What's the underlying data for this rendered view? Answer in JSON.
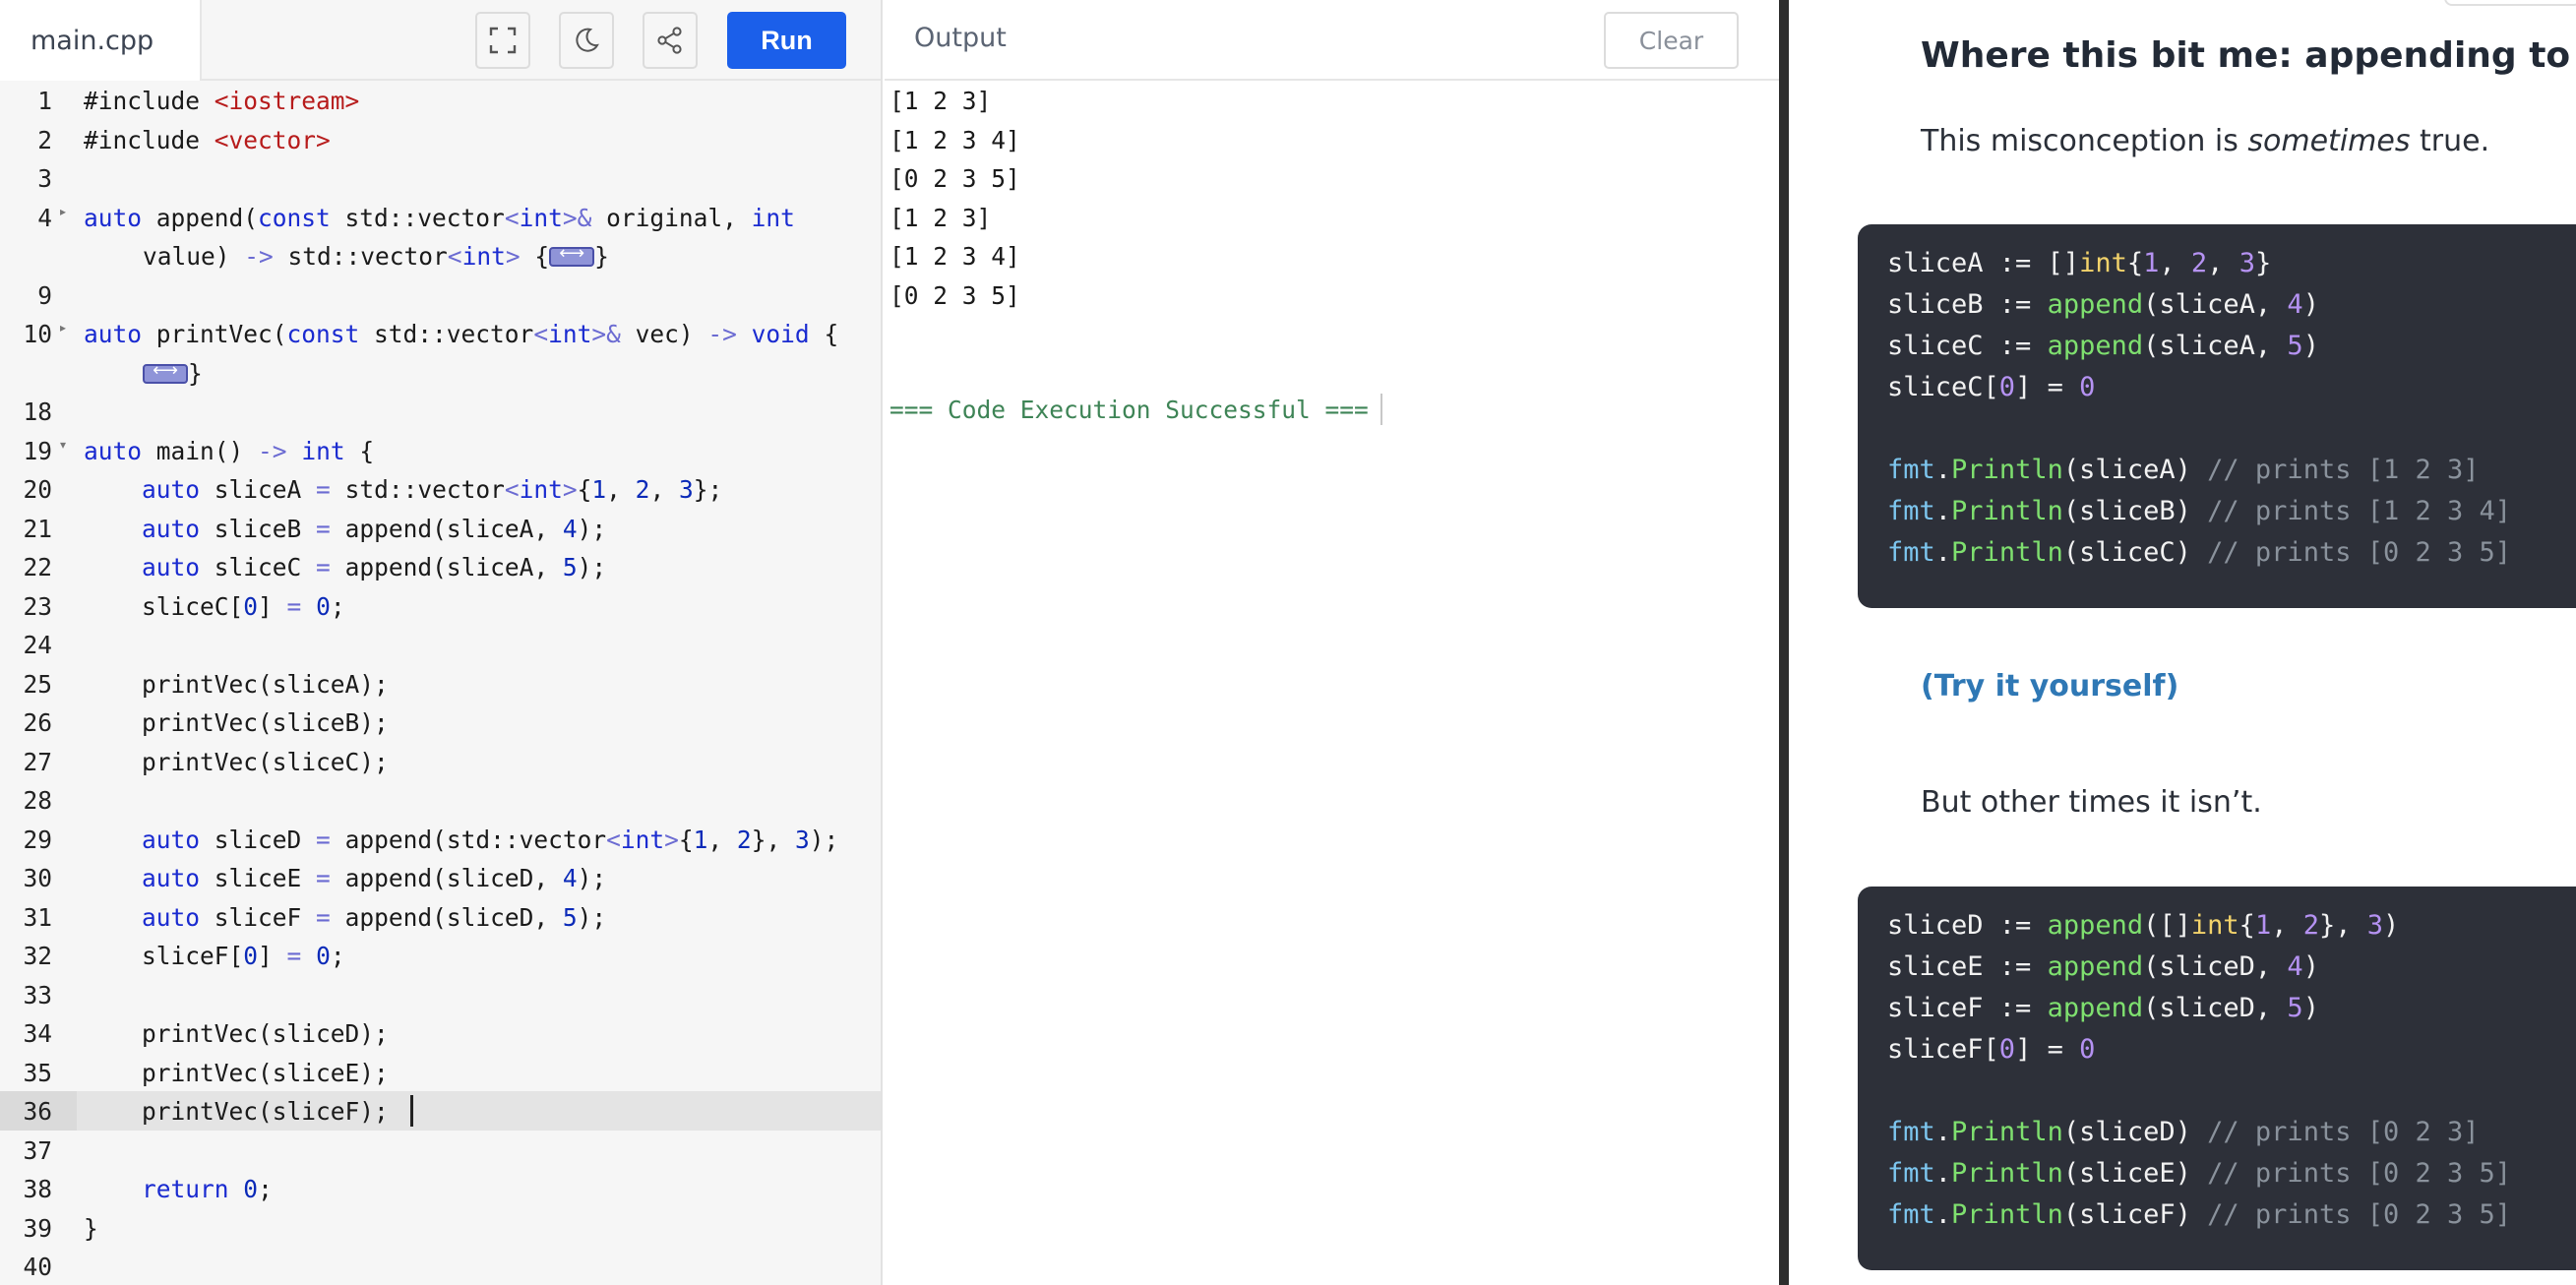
{
  "editor": {
    "file_tab": "main.cpp",
    "run_label": "Run",
    "icons": [
      "fullscreen-icon",
      "moon-icon",
      "share-icon"
    ],
    "lines": [
      {
        "n": "1",
        "code": "#include <iostream>"
      },
      {
        "n": "2",
        "code": "#include <vector>"
      },
      {
        "n": "3",
        "code": ""
      },
      {
        "n": "4",
        "code": "auto append(const std::vector<int>& original, int",
        "wrap": "value) -> std::vector<int> {⟷}"
      },
      {
        "n": "9",
        "code": ""
      },
      {
        "n": "10",
        "code": "auto printVec(const std::vector<int>& vec) -> void {",
        "wrap": "⟷}"
      },
      {
        "n": "18",
        "code": ""
      },
      {
        "n": "19",
        "code": "auto main() -> int {"
      },
      {
        "n": "20",
        "code": "    auto sliceA = std::vector<int>{1, 2, 3};"
      },
      {
        "n": "21",
        "code": "    auto sliceB = append(sliceA, 4);"
      },
      {
        "n": "22",
        "code": "    auto sliceC = append(sliceA, 5);"
      },
      {
        "n": "23",
        "code": "    sliceC[0] = 0;"
      },
      {
        "n": "24",
        "code": ""
      },
      {
        "n": "25",
        "code": "    printVec(sliceA);"
      },
      {
        "n": "26",
        "code": "    printVec(sliceB);"
      },
      {
        "n": "27",
        "code": "    printVec(sliceC);"
      },
      {
        "n": "28",
        "code": ""
      },
      {
        "n": "29",
        "code": "    auto sliceD = append(std::vector<int>{1, 2}, 3);"
      },
      {
        "n": "30",
        "code": "    auto sliceE = append(sliceD, 4);"
      },
      {
        "n": "31",
        "code": "    auto sliceF = append(sliceD, 5);"
      },
      {
        "n": "32",
        "code": "    sliceF[0] = 0;"
      },
      {
        "n": "33",
        "code": ""
      },
      {
        "n": "34",
        "code": "    printVec(sliceD);"
      },
      {
        "n": "35",
        "code": "    printVec(sliceE);"
      },
      {
        "n": "36",
        "code": "    printVec(sliceF); "
      },
      {
        "n": "37",
        "code": ""
      },
      {
        "n": "38",
        "code": "    return 0;"
      },
      {
        "n": "39",
        "code": "}"
      },
      {
        "n": "40",
        "code": ""
      }
    ]
  },
  "output": {
    "title": "Output",
    "clear_label": "Clear",
    "lines": [
      "[1 2 3]",
      "[1 2 3 4]",
      "[0 2 3 5]",
      "[1 2 3]",
      "[1 2 3 4]",
      "[0 2 3 5]"
    ],
    "success": "=== Code Execution Successful ==="
  },
  "article": {
    "heading": "Where this bit me: appending to a slice",
    "para1_prefix": "This misconception is ",
    "para1_em": "sometimes",
    "para1_suffix": " true.",
    "link": "(Try it yourself)",
    "para2": "But other times it isn’t.",
    "block1": [
      "sliceA := []int{1, 2, 3}",
      "sliceB := append(sliceA, 4)",
      "sliceC := append(sliceA, 5)",
      "sliceC[0] = 0",
      "",
      "fmt.Println(sliceA) // prints [1 2 3]",
      "fmt.Println(sliceB) // prints [1 2 3 4]",
      "fmt.Println(sliceC) // prints [0 2 3 5]"
    ],
    "block2": [
      "sliceD := append([]int{1, 2}, 3)",
      "sliceE := append(sliceD, 4)",
      "sliceF := append(sliceD, 5)",
      "sliceF[0] = 0",
      "",
      "fmt.Println(sliceD) // prints [0 2 3]",
      "fmt.Println(sliceE) // prints [0 2 3 5]",
      "fmt.Println(sliceF) // prints [0 2 3 5]"
    ]
  }
}
